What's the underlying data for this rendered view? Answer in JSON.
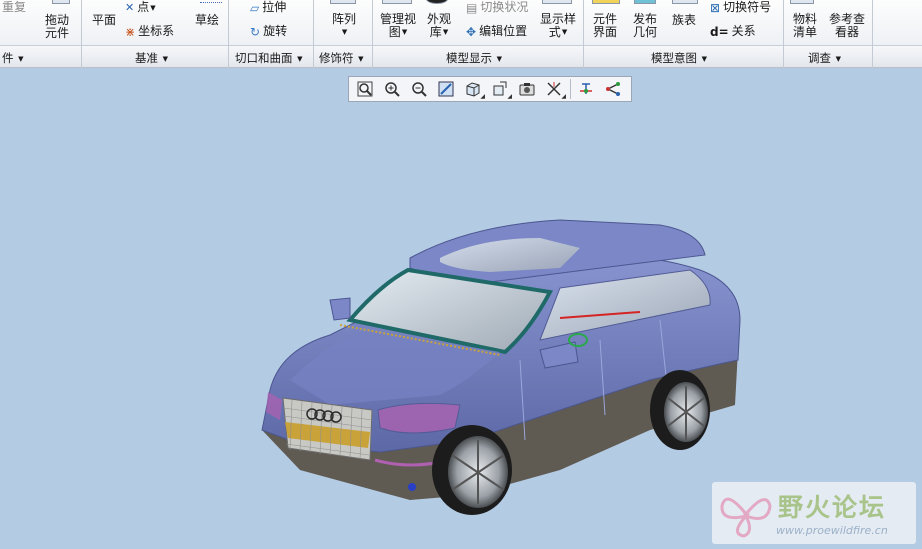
{
  "ribbon": {
    "undo_partial": "重复",
    "drag_component": [
      "拖动",
      "元件"
    ],
    "plane": "平面",
    "point": "点",
    "csys": "坐标系",
    "sketch": "草绘",
    "extrude": "拉伸",
    "revolve": "旋转",
    "pattern": "阵列",
    "manage_views": [
      "管理视",
      "图"
    ],
    "appearance_gallery": [
      "外观",
      "库"
    ],
    "switch_state": "切换状况",
    "edit_position": "编辑位置",
    "display_style": [
      "显示样",
      "式"
    ],
    "component_interface": [
      "元件",
      "界面"
    ],
    "publish_geometry": [
      "发布",
      "几何"
    ],
    "family_table": "族表",
    "switch_symbol": "切换符号",
    "relations": "关系",
    "relations_prefix": "d=",
    "bom": [
      "物料",
      "清单"
    ],
    "reference_viewer": [
      "参考查",
      "看器"
    ]
  },
  "groups": {
    "part": "件",
    "datum": "基准",
    "cut_surface": "切口和曲面",
    "modifiers": "修饰符",
    "model_display": "模型显示",
    "model_intent": "模型意图",
    "investigate": "调查"
  },
  "graphics_toolbar": [
    {
      "name": "refit-icon"
    },
    {
      "name": "zoom-in-icon"
    },
    {
      "name": "zoom-out-icon"
    },
    {
      "name": "repaint-icon"
    },
    {
      "name": "display-style-icon"
    },
    {
      "name": "saved-orientations-icon"
    },
    {
      "name": "view-manager-icon"
    },
    {
      "name": "datum-display-icon"
    },
    {
      "name": "spin-center-icon"
    },
    {
      "name": "annotation-display-icon"
    }
  ],
  "watermark": {
    "title": "野火论坛",
    "url": "www.proewildfire.cn"
  },
  "colors": {
    "viewport_bg": "#b4cbe4",
    "car_body": "#6b79b8",
    "car_lower": "#5f5a52",
    "windshield_trim": "#1f6a68"
  }
}
